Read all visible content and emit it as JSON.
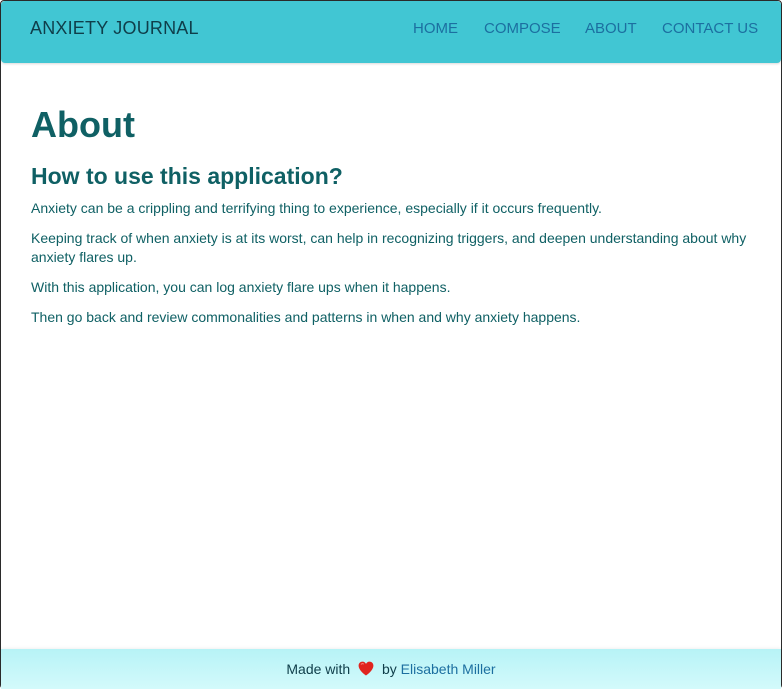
{
  "navbar": {
    "brand": "ANXIETY JOURNAL",
    "links": [
      "HOME",
      "COMPOSE",
      "ABOUT",
      "CONTACT US"
    ]
  },
  "main": {
    "title": "About",
    "subtitle": "How to use this application?",
    "paragraphs": [
      "Anxiety can be a crippling and terrifying thing to experience, especially if it occurs frequently.",
      "Keeping track of when anxiety is at its worst, can help in recognizing triggers, and deepen understanding about why anxiety flares up.",
      "With this application, you can log anxiety flare ups when it happens.",
      "Then go back and review commonalities and patterns in when and why anxiety happens."
    ]
  },
  "footer": {
    "prefix": "Made with",
    "heart_icon": "heart-icon",
    "by": "by",
    "author": "Elisabeth Miller"
  },
  "colors": {
    "navbar": "#41c6d3",
    "text": "#0f6064",
    "link": "#1c6fa0",
    "heart": "#e0241f"
  }
}
